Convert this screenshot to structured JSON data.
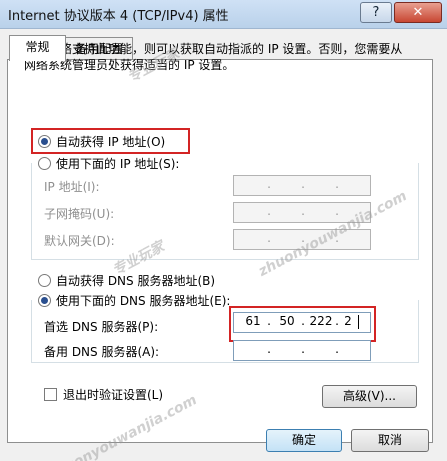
{
  "window": {
    "title": "Internet 协议版本 4 (TCP/IPv4) 属性",
    "help_label": "?",
    "close_label": "✕"
  },
  "tabs": [
    {
      "label": "常规"
    },
    {
      "label": "备用配置"
    }
  ],
  "description": "如果网络支持此功能，则可以获取自动指派的 IP 设置。否则，您需要从网络系统管理员处获得适当的 IP 设置。",
  "ip": {
    "auto_label": "自动获得 IP 地址(O)",
    "manual_label": "使用下面的 IP 地址(S):",
    "address_label": "IP 地址(I):",
    "mask_label": "子网掩码(U):",
    "gateway_label": "默认网关(D):",
    "auto_selected": true
  },
  "dns": {
    "auto_label": "自动获得 DNS 服务器地址(B)",
    "manual_label": "使用下面的 DNS 服务器地址(E):",
    "preferred_label": "首选 DNS 服务器(P):",
    "alternate_label": "备用 DNS 服务器(A):",
    "preferred": {
      "o1": "61",
      "o2": "50",
      "o3": "222",
      "o4": "2"
    },
    "manual_selected": true
  },
  "validate_label": "退出时验证设置(L)",
  "advanced_label": "高级(V)...",
  "ok_label": "确定",
  "cancel_label": "取消",
  "watermarks": {
    "a": "专业玩家",
    "b": "zhuonyouwanjia.com",
    "c": "专业玩家",
    "d": "zhuonyouwanjia.com"
  },
  "colors": {
    "highlight_box": "#d32424",
    "selected_radio": "#2a4f8f"
  }
}
